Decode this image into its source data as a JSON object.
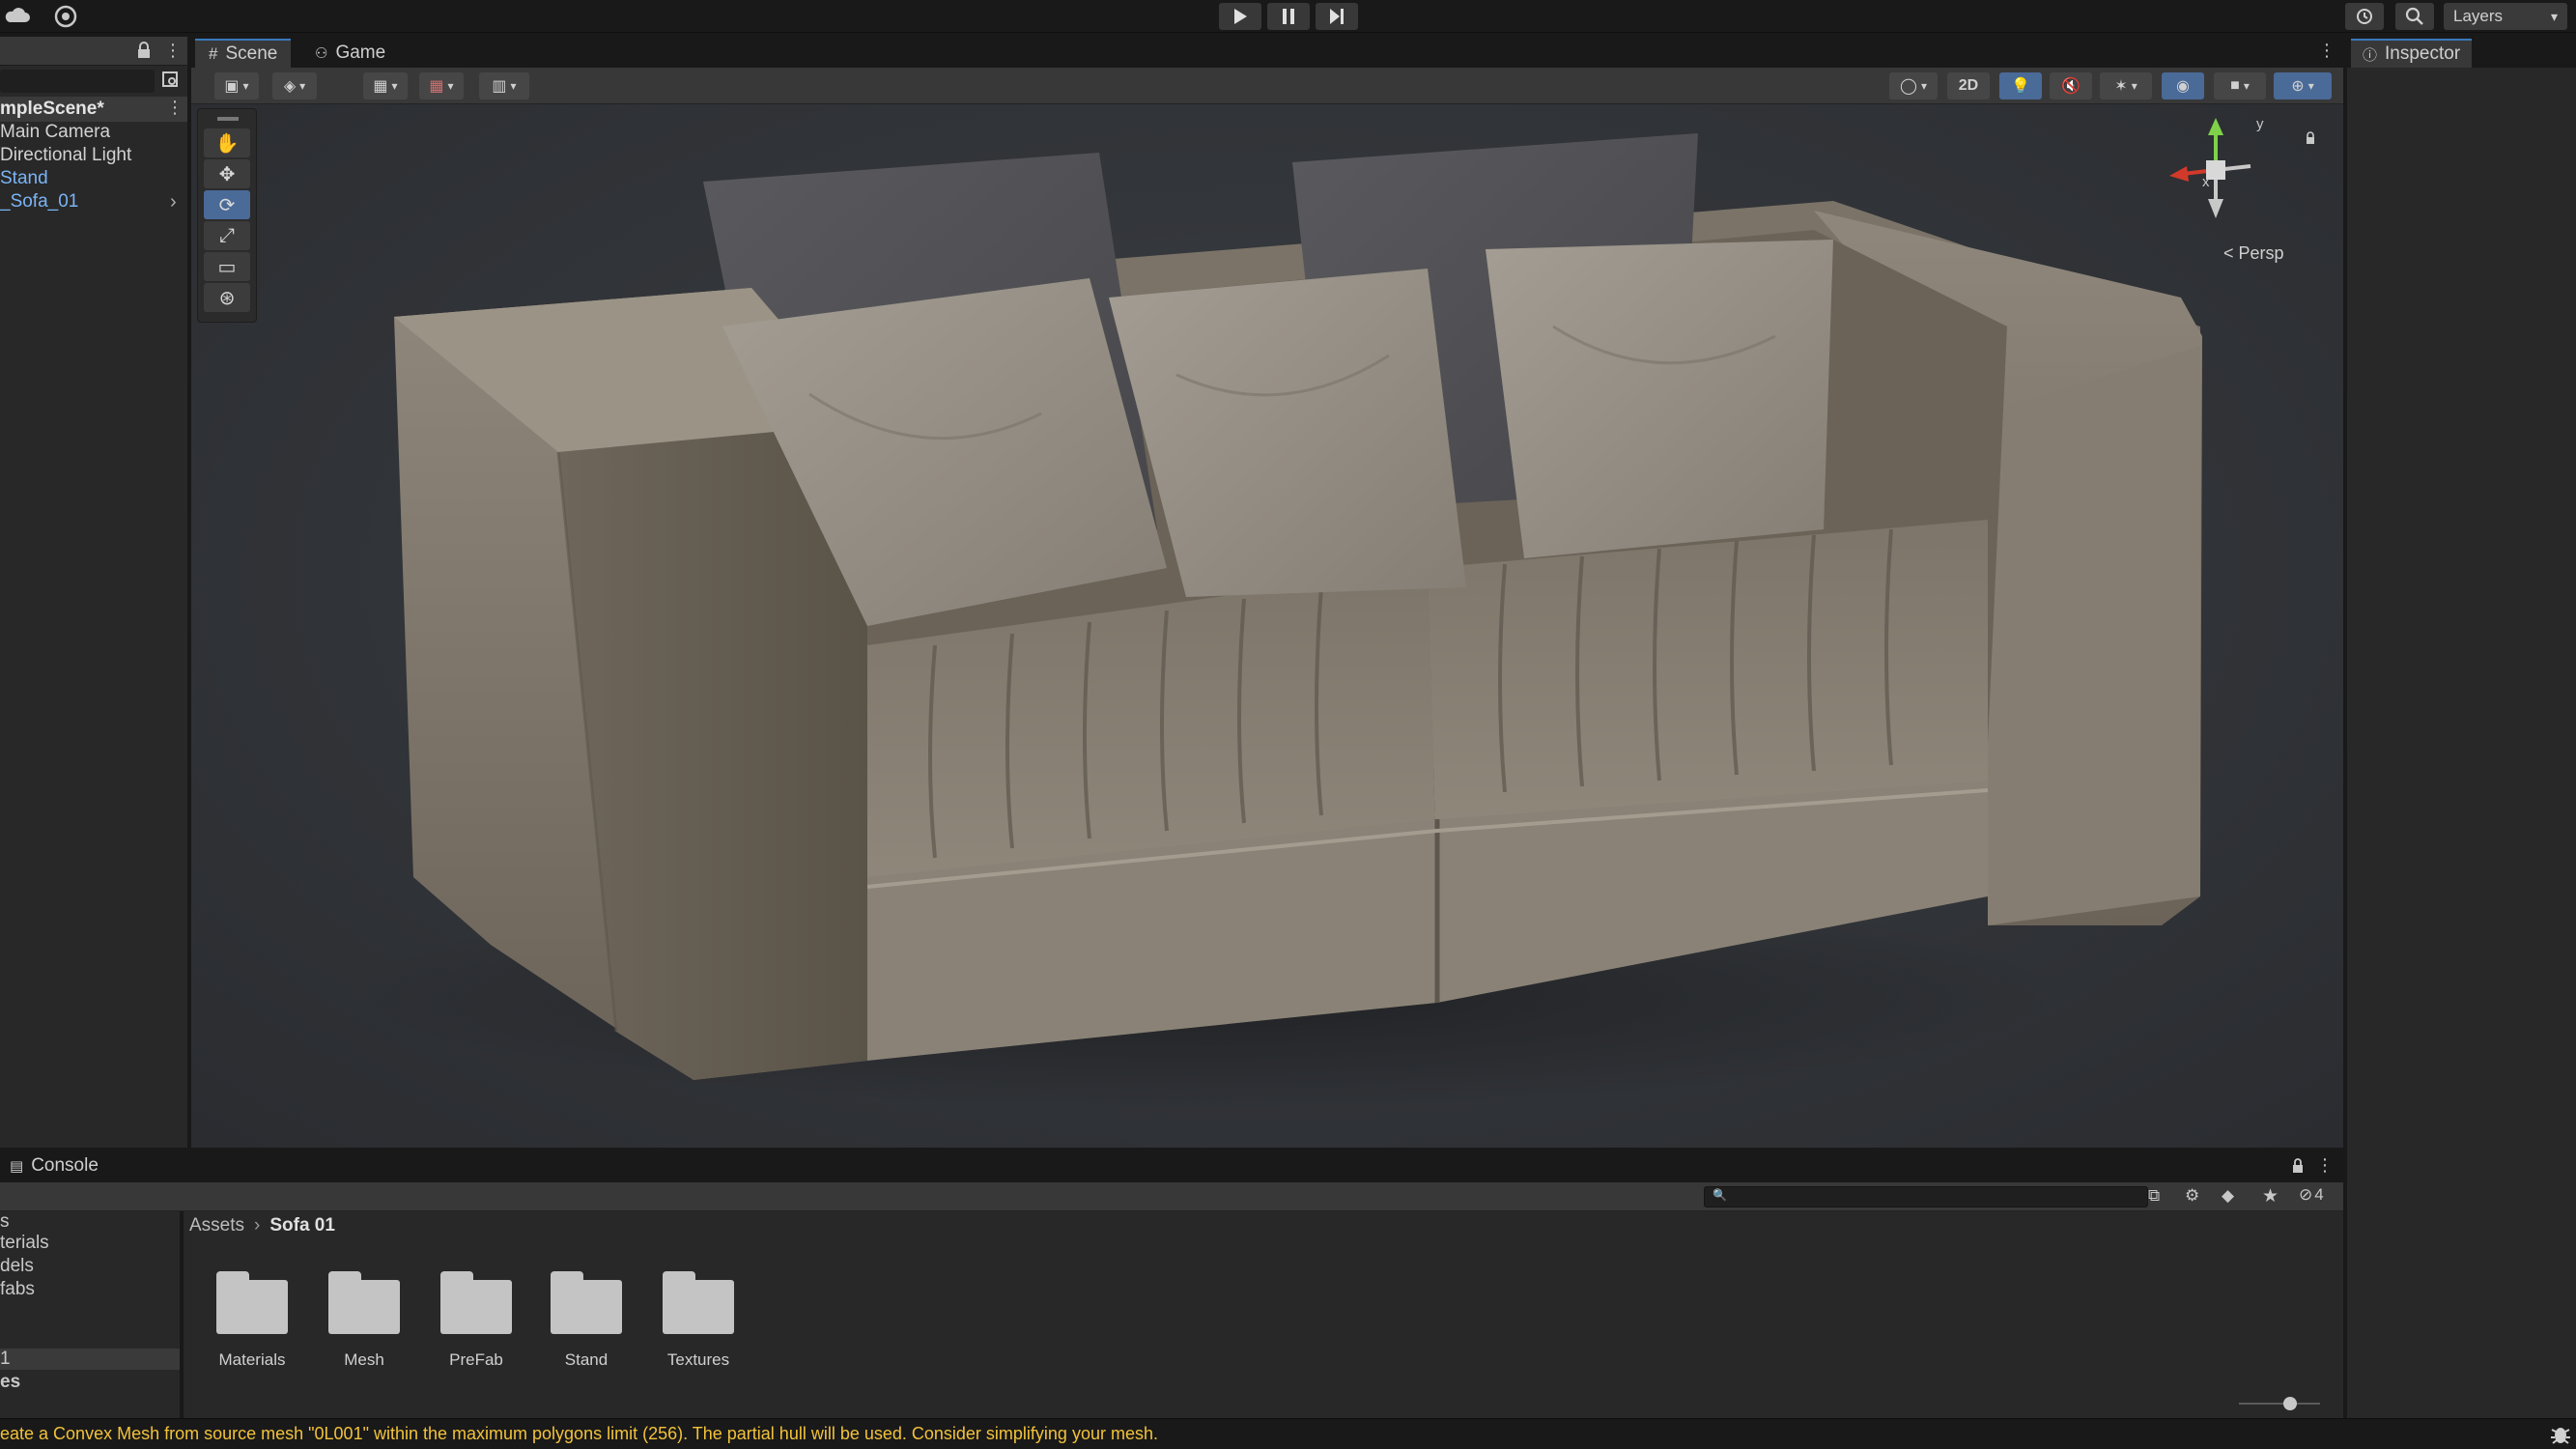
{
  "topbar": {
    "layers_label": "Layers"
  },
  "hierarchy": {
    "scene_name": "mpleScene*",
    "items": [
      {
        "label": "Main Camera"
      },
      {
        "label": "Directional Light"
      },
      {
        "label": "Stand"
      },
      {
        "label": "_Sofa_01"
      }
    ]
  },
  "scene_tabs": [
    {
      "label": "Scene"
    },
    {
      "label": "Game"
    }
  ],
  "scene_toolbar": {
    "mode_2d": "2D"
  },
  "gizmo": {
    "y": "y",
    "x": "x",
    "persp": "< Persp"
  },
  "inspector": {
    "title": "Inspector"
  },
  "console": {
    "tab_label": "Console"
  },
  "project": {
    "hidden_count": "4",
    "breadcrumb": [
      "Assets",
      "Sofa 01"
    ],
    "left_items": [
      "s",
      "terials",
      "dels",
      "fabs",
      "1",
      "es"
    ],
    "folders": [
      "Materials",
      "Mesh",
      "PreFab",
      "Stand",
      "Textures"
    ]
  },
  "status": {
    "message": "eate a Convex Mesh from source mesh \"0L001\" within the maximum polygons limit (256). The partial hull will be used. Consider simplifying your mesh."
  },
  "colors": {
    "accent": "#4a6a98",
    "warning": "#f2c23a",
    "panel": "#282828",
    "dark": "#191919"
  }
}
